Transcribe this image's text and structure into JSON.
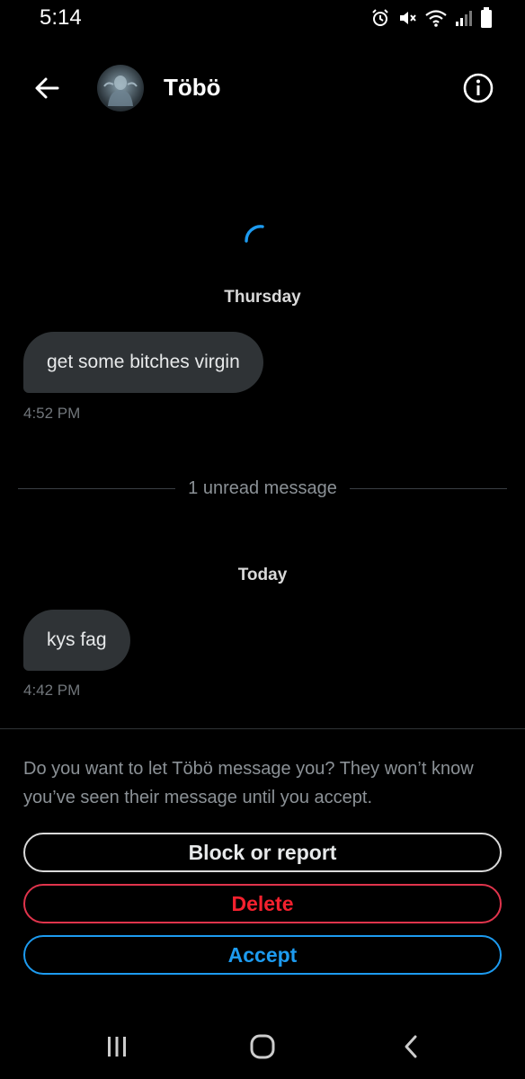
{
  "status_bar": {
    "time": "5:14",
    "icons": [
      "alarm-icon",
      "mute-icon",
      "wifi-icon",
      "signal-icon",
      "battery-icon"
    ]
  },
  "header": {
    "contact_name": "Töbö",
    "back_icon": "arrow-left-icon",
    "info_icon": "info-icon"
  },
  "conversation": {
    "groups": [
      {
        "day": "Thursday",
        "message": "get some bitches virgin",
        "time": "4:52 PM"
      },
      {
        "day": "Today",
        "message": "kys fag",
        "time": "4:42 PM"
      }
    ],
    "unread_divider": "1 unread message"
  },
  "request_panel": {
    "prompt": "Do you want to let Töbö message you? They won’t know you’ve seen their message until you accept.",
    "block_label": "Block or report",
    "delete_label": "Delete",
    "accept_label": "Accept"
  },
  "colors": {
    "background": "#000000",
    "bubble": "#2f3336",
    "accent_blue": "#1d9bf0",
    "danger_red": "#f4212e",
    "muted_text": "#71767b"
  },
  "nav_bar": {
    "icons": [
      "recents-icon",
      "home-icon",
      "back-icon"
    ]
  }
}
